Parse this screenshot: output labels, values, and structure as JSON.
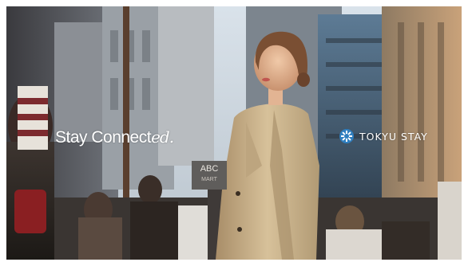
{
  "ad": {
    "tagline_main": "Stay Connect",
    "tagline_script": "ed.",
    "brand_name": "TOKYU STAY",
    "brand_mark": "tokyu-stay-logo-icon",
    "street_sign": "ABC",
    "street_sign_sub": "MART"
  },
  "colors": {
    "coat": "#c8b08a",
    "sky": "#cfd8e2",
    "brand_mark_blue": "#2f7fc0"
  }
}
